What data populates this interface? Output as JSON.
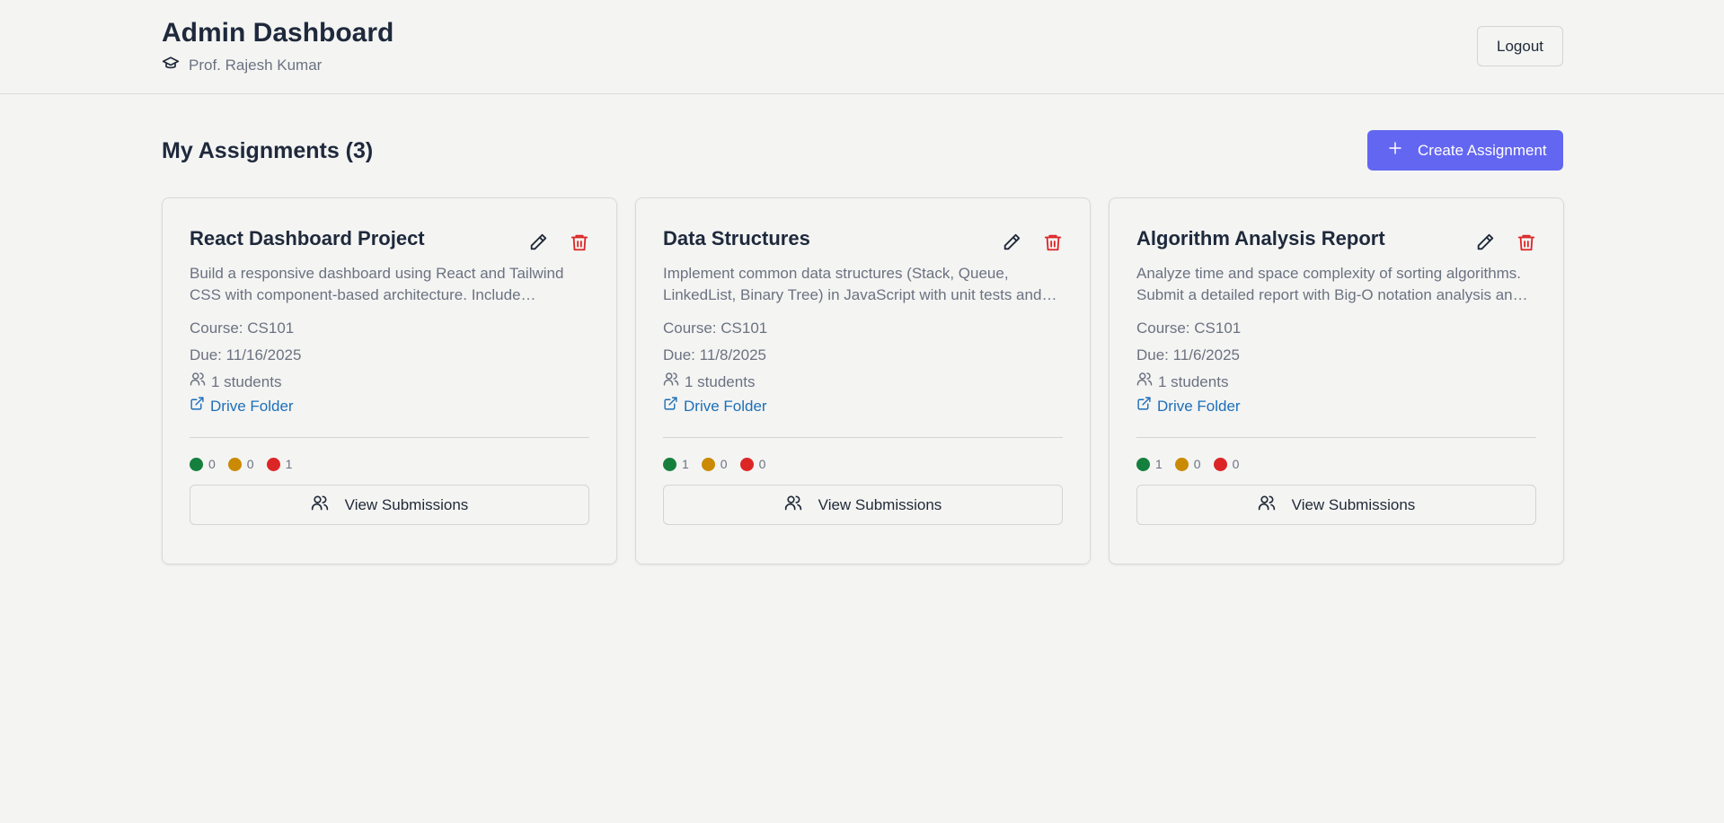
{
  "header": {
    "title": "Admin Dashboard",
    "user_name": "Prof. Rajesh Kumar",
    "logout_label": "Logout"
  },
  "main": {
    "section_title": "My Assignments (3)",
    "create_label": "Create Assignment"
  },
  "assignments": [
    {
      "title": "React Dashboard Project",
      "description": "Build a responsive dashboard using React and Tailwind CSS with component-based architecture. Include interactive charts and data tables.",
      "course": "Course: CS101",
      "due": "Due: 11/16/2025",
      "students": "1 students",
      "drive_label": "Drive Folder",
      "stat_green": "0",
      "stat_yellow": "0",
      "stat_red": "1",
      "view_label": "View Submissions"
    },
    {
      "title": "Data Structures",
      "description": "Implement common data structures (Stack, Queue, LinkedList, Binary Tree) in JavaScript with unit tests and documentation.",
      "course": "Course: CS101",
      "due": "Due: 11/8/2025",
      "students": "1 students",
      "drive_label": "Drive Folder",
      "stat_green": "1",
      "stat_yellow": "0",
      "stat_red": "0",
      "view_label": "View Submissions"
    },
    {
      "title": "Algorithm Analysis Report",
      "description": "Analyze time and space complexity of sorting algorithms. Submit a detailed report with Big-O notation analysis and benchmarks.",
      "course": "Course: CS101",
      "due": "Due: 11/6/2025",
      "students": "1 students",
      "drive_label": "Drive Folder",
      "stat_green": "1",
      "stat_yellow": "0",
      "stat_red": "0",
      "view_label": "View Submissions"
    }
  ],
  "colors": {
    "accent": "#6366f1",
    "link": "#1d6fb8",
    "delete": "#dc2626",
    "status_green": "#15803d",
    "status_yellow": "#ca8a04",
    "status_red": "#dc2626"
  },
  "icons": {
    "user": "graduation-cap-icon",
    "create": "plus-icon",
    "edit": "pencil-icon",
    "delete": "trash-icon",
    "students": "users-icon",
    "drive": "external-link-icon",
    "view": "users-icon"
  }
}
